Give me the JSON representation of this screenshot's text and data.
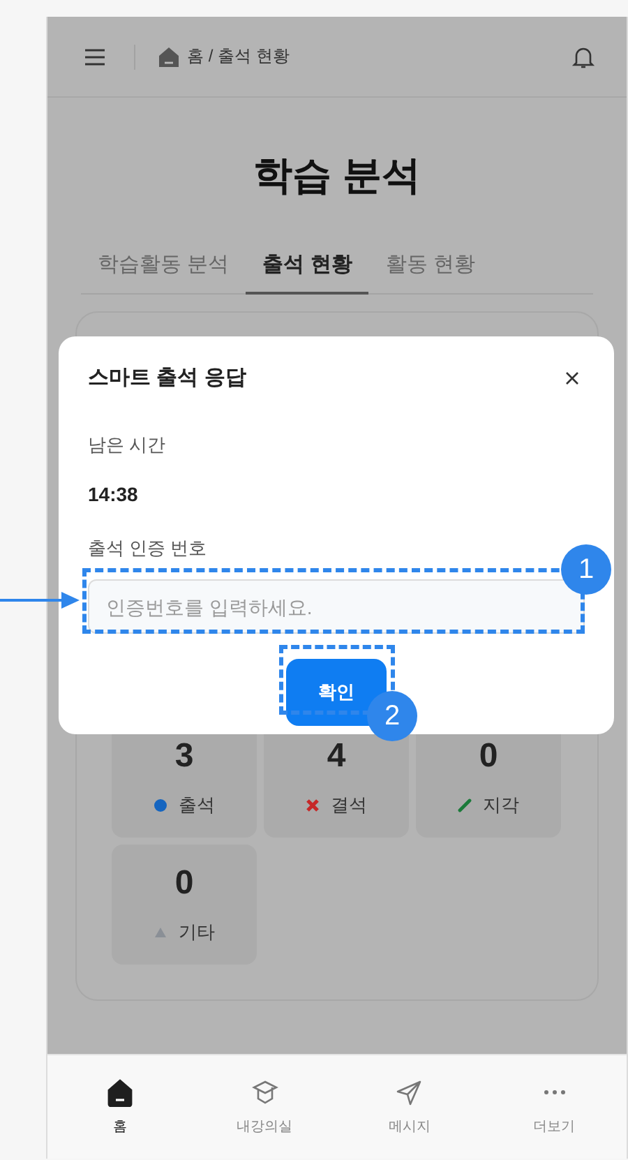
{
  "header": {
    "breadcrumb": "홈 / 출석 현황"
  },
  "title": "학습 분석",
  "tabs": [
    {
      "label": "학습활동 분석",
      "selected": false
    },
    {
      "label": "출석 현황",
      "selected": true
    },
    {
      "label": "활동 현황",
      "selected": false
    }
  ],
  "stats": [
    {
      "value": "3",
      "label": "출석",
      "kind": "dot",
      "color": "#1565c0"
    },
    {
      "value": "4",
      "label": "결석",
      "kind": "cross",
      "color": "#c62828"
    },
    {
      "value": "0",
      "label": "지각",
      "kind": "pencil",
      "color": "#1b7a3a"
    },
    {
      "value": "0",
      "label": "기타",
      "kind": "triangle",
      "color": "#8a8f96"
    }
  ],
  "modal": {
    "title": "스마트 출석 응답",
    "remaining_label": "남은 시간",
    "remaining_value": "14:38",
    "code_label": "출석 인증 번호",
    "code_placeholder": "인증번호를 입력하세요.",
    "confirm": "확인"
  },
  "annotations": [
    {
      "label": "1"
    },
    {
      "label": "2"
    }
  ],
  "nav": [
    {
      "label": "홈",
      "kind": "home",
      "selected": true
    },
    {
      "label": "내강의실",
      "kind": "cap",
      "selected": false
    },
    {
      "label": "메시지",
      "kind": "send",
      "selected": false
    },
    {
      "label": "더보기",
      "kind": "more",
      "selected": false
    }
  ]
}
